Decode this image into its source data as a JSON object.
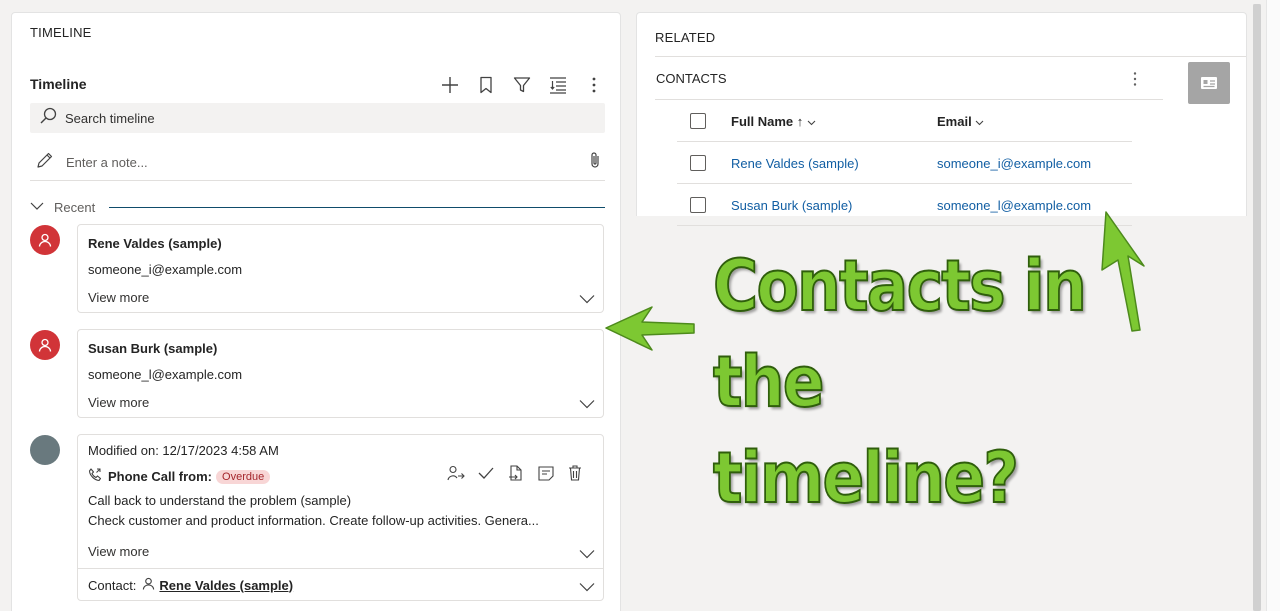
{
  "timeline": {
    "section_caption": "TIMELINE",
    "header_title": "Timeline",
    "search_placeholder": "Search timeline",
    "note_placeholder": "Enter a note...",
    "recent_label": "Recent",
    "tools": [
      "add-icon",
      "bookmark-icon",
      "filter-icon",
      "sort-icon",
      "more-vertical-icon"
    ],
    "cards": [
      {
        "name": "Rene Valdes (sample)",
        "email": "someone_i@example.com",
        "view_more": "View more"
      },
      {
        "name": "Susan Burk (sample)",
        "email": "someone_l@example.com",
        "view_more": "View more"
      }
    ],
    "activity": {
      "modified": "Modified on: 12/17/2023 4:58 AM",
      "type_label": "Phone Call from:",
      "badge": "Overdue",
      "subject": "Call back to understand the problem (sample)",
      "description": "Check customer and product information. Create follow-up activities. Genera...",
      "view_more": "View more",
      "contact_label": "Contact:",
      "contact_name": "Rene Valdes (sample)"
    }
  },
  "related": {
    "section_caption": "RELATED",
    "contacts_title": "CONTACTS",
    "columns": {
      "full_name": "Full Name",
      "email": "Email"
    },
    "rows": [
      {
        "full_name": "Rene Valdes (sample)",
        "email": "someone_i@example.com"
      },
      {
        "full_name": "Susan Burk (sample)",
        "email": "someone_l@example.com"
      }
    ]
  },
  "annotation": {
    "line1": "Contacts in",
    "line2": "the timeline?"
  },
  "colors": {
    "avatar_red": "#d13438",
    "avatar_grey": "#69797e",
    "link_blue": "#115ea3",
    "annotation_green": "#7dc832",
    "badge_bg": "#f8d6d6"
  }
}
